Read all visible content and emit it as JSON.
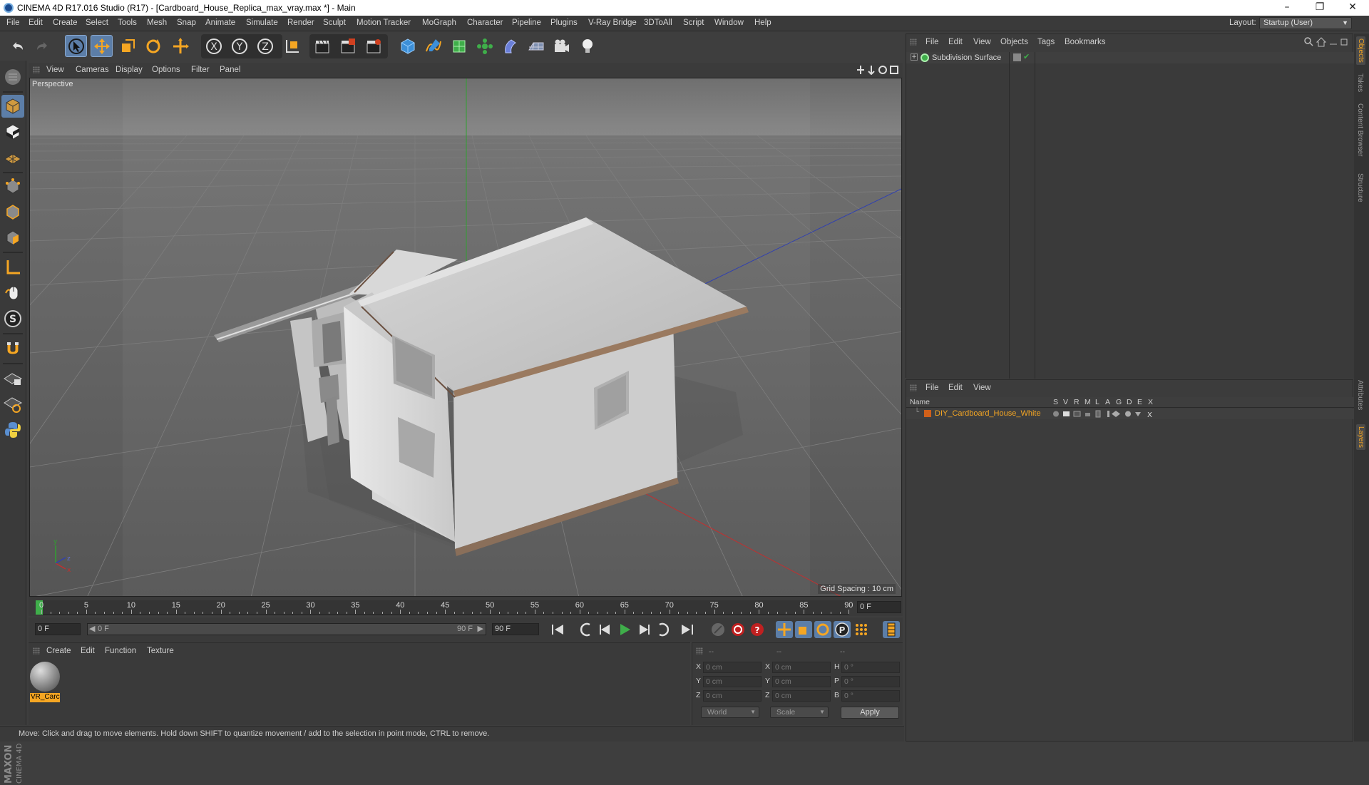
{
  "window": {
    "title": "CINEMA 4D R17.016 Studio (R17) - [Cardboard_House_Replica_max_vray.max *] - Main",
    "controls": {
      "minimize": "–",
      "restore": "❐",
      "close": "✕"
    }
  },
  "menubar": {
    "items": [
      "File",
      "Edit",
      "Create",
      "Select",
      "Tools",
      "Mesh",
      "Snap",
      "Animate",
      "Simulate",
      "Render",
      "Sculpt",
      "Motion Tracker",
      "MoGraph",
      "Character",
      "Pipeline",
      "Plugins",
      "V-Ray Bridge",
      "3DToAll",
      "Script",
      "Window",
      "Help"
    ],
    "layout_label": "Layout:",
    "layout_value": "Startup (User)"
  },
  "viewport": {
    "menu": [
      "View",
      "Cameras",
      "Display",
      "Options",
      "Filter",
      "Panel"
    ],
    "label": "Perspective",
    "grid_spacing": "Grid Spacing : 10 cm"
  },
  "timeline": {
    "ticks": [
      "0",
      "5",
      "10",
      "15",
      "20",
      "25",
      "30",
      "35",
      "40",
      "45",
      "50",
      "55",
      "60",
      "65",
      "70",
      "75",
      "80",
      "85",
      "90"
    ],
    "end_field": "0 F"
  },
  "transport": {
    "start_field": "0 F",
    "range_start": "0 F",
    "range_end": "90 F",
    "end_field": "90 F"
  },
  "material_manager": {
    "menu": [
      "Create",
      "Edit",
      "Function",
      "Texture"
    ],
    "material_name": "VR_Carc"
  },
  "coordinates": {
    "headers": [
      "--",
      "--",
      "--"
    ],
    "rows": [
      {
        "l1": "X",
        "v1": "0 cm",
        "l2": "X",
        "v2": "0 cm",
        "l3": "H",
        "v3": "0 °"
      },
      {
        "l1": "Y",
        "v1": "0 cm",
        "l2": "Y",
        "v2": "0 cm",
        "l3": "P",
        "v3": "0 °"
      },
      {
        "l1": "Z",
        "v1": "0 cm",
        "l2": "Z",
        "v2": "0 cm",
        "l3": "B",
        "v3": "0 °"
      }
    ],
    "space": "World",
    "mode": "Scale",
    "apply": "Apply"
  },
  "status": {
    "text": "Move: Click and drag to move elements. Hold down SHIFT to quantize movement / add to the selection in point mode, CTRL to remove."
  },
  "object_manager": {
    "menu": [
      "File",
      "Edit",
      "View",
      "Objects",
      "Tags",
      "Bookmarks"
    ],
    "object": "Subdivision Surface"
  },
  "layer_manager": {
    "menu": [
      "File",
      "Edit",
      "View"
    ],
    "columns": [
      "Name",
      "S",
      "V",
      "R",
      "M",
      "L",
      "A",
      "G",
      "D",
      "E",
      "X"
    ],
    "layer": "DIY_Cardboard_House_White"
  },
  "right_tabs": [
    "Objects",
    "Takes",
    "Content Browser",
    "Structure",
    "Attributes",
    "Layers"
  ],
  "colors": {
    "accent": "#f5a623",
    "active": "#5c7ea8",
    "axis_x": "#c03030",
    "axis_y": "#30a030",
    "axis_z": "#3040b0"
  }
}
